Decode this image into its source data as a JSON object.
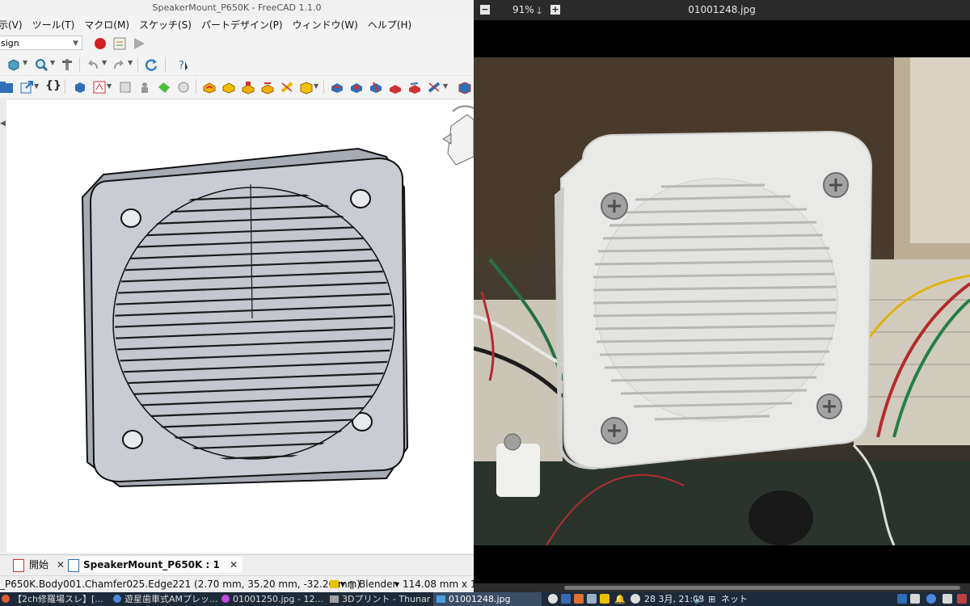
{
  "freecad": {
    "title": "SpeakerMount_P650K - FreeCAD 1.1.0",
    "menu": [
      "示(V)",
      "ツール(T)",
      "マクロ(M)",
      "スケッチ(S)",
      "パートデザイン(P)",
      "ウィンドウ(W)",
      "ヘルプ(H)"
    ],
    "workbench": "sign",
    "tabs": {
      "start": "開始",
      "doc": "SpeakerMount_P650K : 1"
    },
    "status": {
      "selection": "_P650K.Body001.Chamfer025.Edge221 (2.70 mm, 35.20 mm, -32.26 mm)",
      "nav": "Blender",
      "dims": "114.08 mm x 102"
    }
  },
  "viewer": {
    "zoom": "91%",
    "filename": "01001248.jpg"
  },
  "taskbar": {
    "tasks": [
      "【2ch修羅場スレ】[...",
      "遊星歯車式AMプレッ...",
      "01001250.jpg - 12...",
      "3Dプリント - Thunar",
      "01001248.jpg"
    ],
    "clock": "28 3月, 21:08",
    "net": "ネット"
  },
  "colors": {
    "accent": "#e04a3a",
    "taskbar": "#1d2a3a",
    "viewport_part": "#c9ccd2"
  }
}
